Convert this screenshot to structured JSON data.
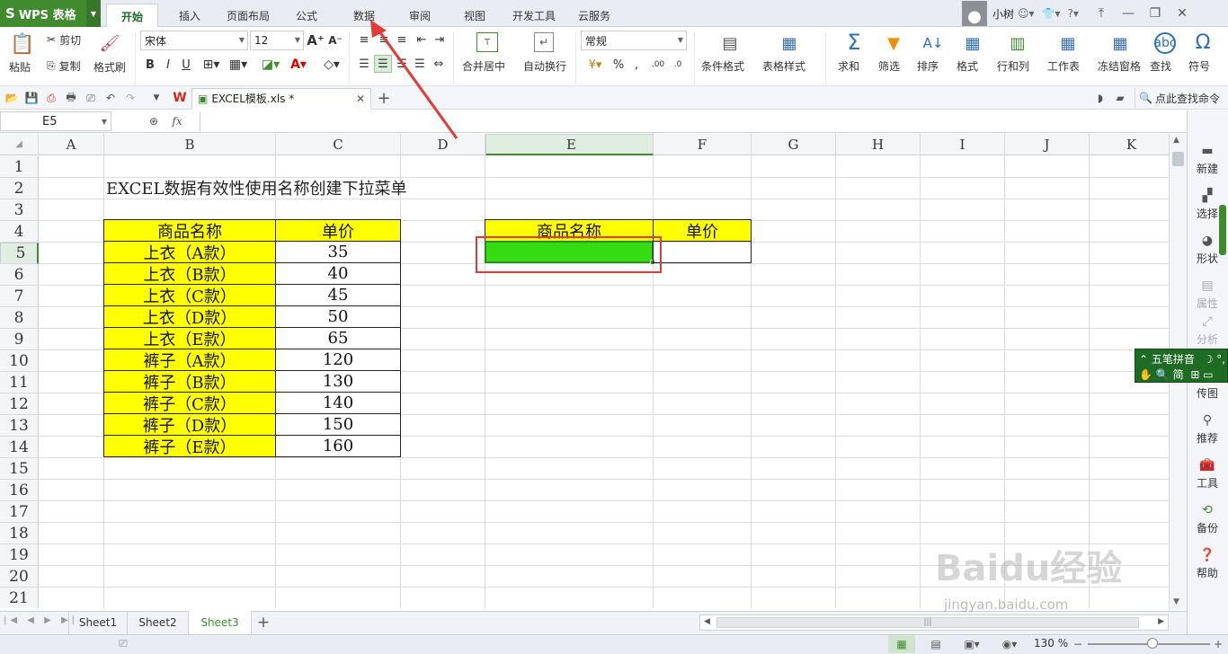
{
  "app": {
    "logo_label": "WPS 表格"
  },
  "menu_tabs": [
    "开始",
    "插入",
    "页面布局",
    "公式",
    "数据",
    "审阅",
    "视图",
    "开发工具",
    "云服务"
  ],
  "user": {
    "name": "小树"
  },
  "ribbon": {
    "paste": "粘贴",
    "cut": "剪切",
    "copy": "复制",
    "format_painter": "格式刷",
    "font_name": "宋体",
    "font_size": "12",
    "merge_center": "合并居中",
    "wrap_text": "自动换行",
    "number_format": "常规",
    "conditional_format": "条件格式",
    "table_style": "表格样式",
    "sum": "求和",
    "filter": "筛选",
    "sort": "排序",
    "format": "格式",
    "rows_cols": "行和列",
    "worksheet": "工作表",
    "freeze": "冻结窗格",
    "find": "查找",
    "symbol": "符号"
  },
  "quickbar": {
    "doc_name": "EXCEL模板.xls *",
    "find_command": "点此查找命令"
  },
  "formula_bar": {
    "name_box": "E5",
    "fx": "fx",
    "content": ""
  },
  "columns": [
    "A",
    "B",
    "C",
    "D",
    "E",
    "F",
    "G",
    "H",
    "I",
    "J",
    "K"
  ],
  "rows": [
    "1",
    "2",
    "3",
    "4",
    "5",
    "6",
    "7",
    "8",
    "9",
    "10",
    "11",
    "12",
    "13",
    "14",
    "15",
    "16",
    "17",
    "18",
    "19",
    "20",
    "21"
  ],
  "sheet": {
    "title": "EXCEL数据有效性使用名称创建下拉菜单",
    "table_header": {
      "name": "商品名称",
      "price": "单价"
    },
    "items": [
      {
        "name": "上衣（A款）",
        "price": "35"
      },
      {
        "name": "上衣（B款）",
        "price": "40"
      },
      {
        "name": "上衣（C款）",
        "price": "45"
      },
      {
        "name": "上衣（D款）",
        "price": "50"
      },
      {
        "name": "上衣（E款）",
        "price": "65"
      },
      {
        "name": "裤子（A款）",
        "price": "120"
      },
      {
        "name": "裤子（B款）",
        "price": "130"
      },
      {
        "name": "裤子（C款）",
        "price": "140"
      },
      {
        "name": "裤子（D款）",
        "price": "150"
      },
      {
        "name": "裤子（E款）",
        "price": "160"
      }
    ],
    "lookup_header": {
      "name": "商品名称",
      "price": "单价"
    }
  },
  "sheet_tabs": [
    "Sheet1",
    "Sheet2",
    "Sheet3"
  ],
  "active_sheet": "Sheet3",
  "status": {
    "zoom": "130 %"
  },
  "right_panel": [
    "新建",
    "选择",
    "形状",
    "属性",
    "分析",
    "传图",
    "推荐",
    "工具",
    "备份",
    "帮助"
  ],
  "ime": {
    "line1": "五笔拼音",
    "line2": "简"
  },
  "watermark": {
    "brand": "Baidu经验",
    "url": "jingyan.baidu.com"
  },
  "colors": {
    "accent": "#3f8b2e",
    "highlight_yellow": "#ffff00",
    "selected_fill": "#33dd11",
    "annotation_red": "#e53935"
  }
}
